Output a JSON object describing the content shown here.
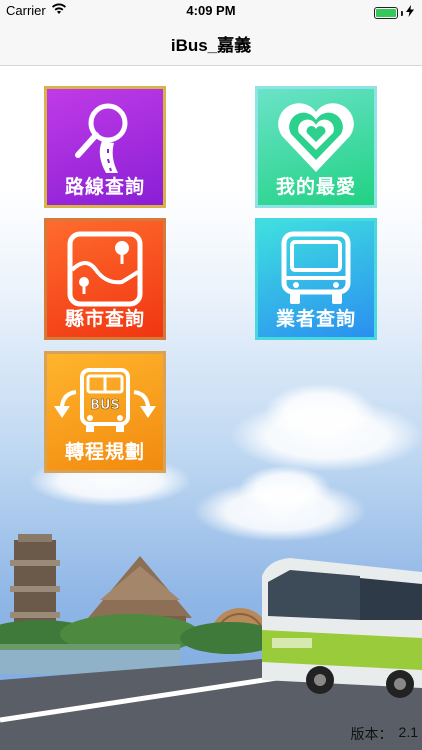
{
  "status_bar": {
    "carrier": "Carrier",
    "time": "4:09 PM"
  },
  "nav": {
    "title": "iBus_嘉義"
  },
  "menu": {
    "route_query": "路線查詢",
    "favorites": "我的最愛",
    "county_query": "縣市查詢",
    "operator_query": "業者查詢",
    "transfer_planning": "轉程規劃",
    "bus_sign": "BUS"
  },
  "footer": {
    "version_label": "版本：",
    "version_value": "2.1"
  },
  "icons": {
    "wifi": "wifi-icon",
    "battery": "battery-icon",
    "charging": "bolt-icon",
    "route": "magnifier-road-icon",
    "favorites": "heart-icon",
    "county": "map-pin-icon",
    "operator": "bus-front-icon",
    "transfer": "bus-arrows-icon"
  },
  "colors": {
    "route_tile": "#8a1fd6",
    "favorites_tile": "#21d183",
    "county_tile": "#f03612",
    "operator_tile": "#2a8ff0",
    "transfer_tile": "#f28a0f"
  }
}
